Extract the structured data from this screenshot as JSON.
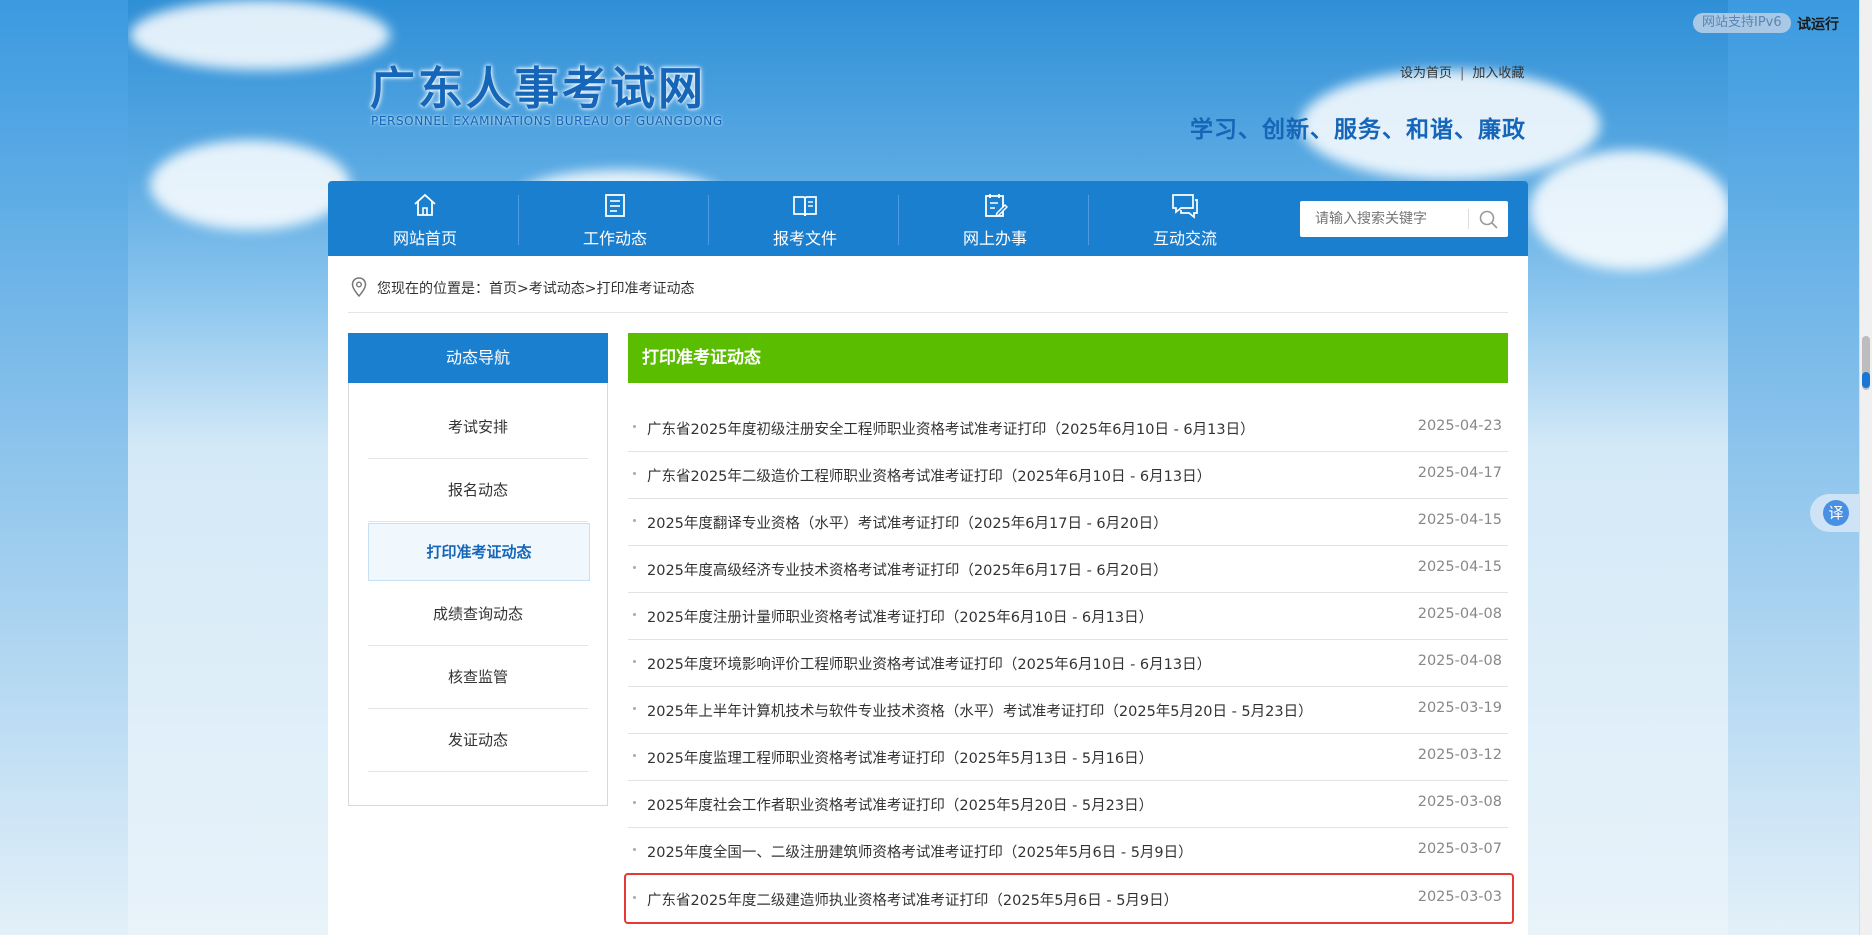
{
  "top_tags": {
    "ipv6": "网站支持IPv6",
    "trial": "试运行"
  },
  "header": {
    "logo_cn": "广东人事考试网",
    "logo_en": "PERSONNEL EXAMINATIONS BUREAU OF GUANGDONG",
    "set_home": "设为首页",
    "separator": "|",
    "add_favorite": "加入收藏",
    "slogan": "学习、创新、服务、和谐、廉政"
  },
  "nav": {
    "items": [
      {
        "label": "网站首页",
        "icon": "home-icon"
      },
      {
        "label": "工作动态",
        "icon": "list-doc-icon"
      },
      {
        "label": "报考文件",
        "icon": "book-icon"
      },
      {
        "label": "网上办事",
        "icon": "clipboard-edit-icon"
      },
      {
        "label": "互动交流",
        "icon": "chat-icon"
      }
    ],
    "search_placeholder": "请输入搜索关键字"
  },
  "breadcrumb": {
    "text": "您现在的位置是：首页>考试动态>打印准考证动态"
  },
  "sidebar": {
    "title": "动态导航",
    "items": [
      {
        "label": "考试安排"
      },
      {
        "label": "报名动态"
      },
      {
        "label": "打印准考证动态"
      },
      {
        "label": "成绩查询动态"
      },
      {
        "label": "核查监管"
      },
      {
        "label": "发证动态"
      }
    ],
    "active_index": 2
  },
  "list": {
    "title": "打印准考证动态",
    "rows": [
      {
        "title": "广东省2025年度初级注册安全工程师职业资格考试准考证打印（2025年6月10日 - 6月13日）",
        "date": "2025-04-23"
      },
      {
        "title": "广东省2025年二级造价工程师职业资格考试准考证打印（2025年6月10日 - 6月13日）",
        "date": "2025-04-17"
      },
      {
        "title": "2025年度翻译专业资格（水平）考试准考证打印（2025年6月17日 - 6月20日）",
        "date": "2025-04-15"
      },
      {
        "title": "2025年度高级经济专业技术资格考试准考证打印（2025年6月17日 - 6月20日）",
        "date": "2025-04-15"
      },
      {
        "title": "2025年度注册计量师职业资格考试准考证打印（2025年6月10日 - 6月13日）",
        "date": "2025-04-08"
      },
      {
        "title": "2025年度环境影响评价工程师职业资格考试准考证打印（2025年6月10日 - 6月13日）",
        "date": "2025-04-08"
      },
      {
        "title": "2025年上半年计算机技术与软件专业技术资格（水平）考试准考证打印（2025年5月20日 - 5月23日）",
        "date": "2025-03-19"
      },
      {
        "title": "2025年度监理工程师职业资格考试准考证打印（2025年5月13日 - 5月16日）",
        "date": "2025-03-12"
      },
      {
        "title": "2025年度社会工作者职业资格考试准考证打印（2025年5月20日 - 5月23日）",
        "date": "2025-03-08"
      },
      {
        "title": "2025年度全国一、二级注册建筑师资格考试准考证打印（2025年5月6日 - 5月9日）",
        "date": "2025-03-07"
      },
      {
        "title": "广东省2025年度二级建造师执业资格考试准考证打印（2025年5月6日 - 5月9日）",
        "date": "2025-03-03"
      }
    ],
    "highlighted_index": 10
  },
  "float": {
    "translate": "译"
  },
  "colors": {
    "nav_blue": "#1b7fd0",
    "list_green": "#5bbd00",
    "highlight_red": "#e53935"
  }
}
